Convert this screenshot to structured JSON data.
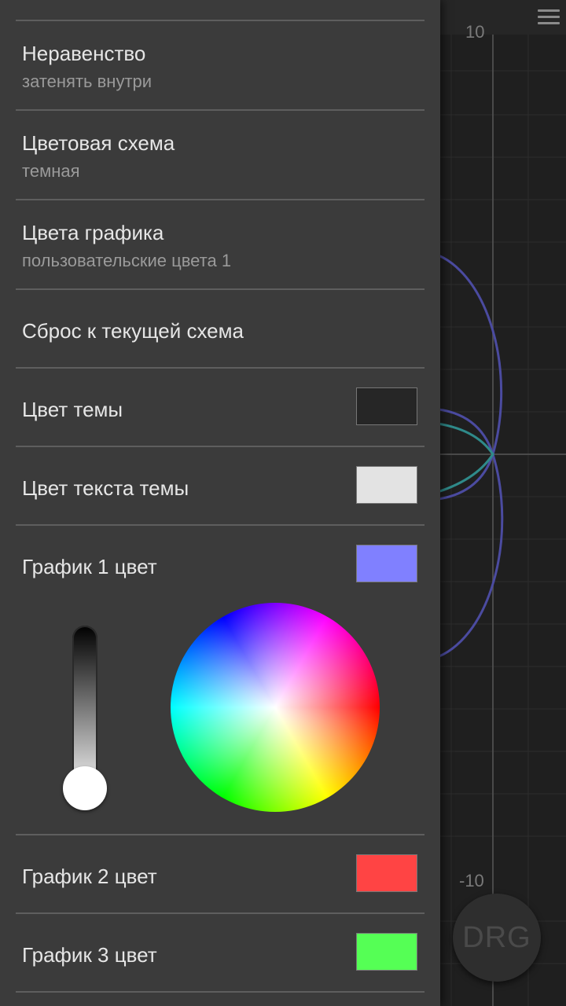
{
  "graph": {
    "tick_top": "10",
    "tick_bottom": "-10",
    "fab_label": "DRG"
  },
  "settings": {
    "inequality": {
      "title": "Неравенство",
      "value": "затенять внутри"
    },
    "color_scheme": {
      "title": "Цветовая схема",
      "value": "темная"
    },
    "graph_colors": {
      "title": "Цвета графика",
      "value": "пользовательские цвета 1"
    },
    "reset": {
      "title": "Сброс к текущей схема"
    },
    "theme_color": {
      "title": "Цвет темы",
      "color": "#262626"
    },
    "theme_text_color": {
      "title": "Цвет текста темы",
      "color": "#e3e3e3"
    },
    "graph1_color": {
      "title": "График 1 цвет",
      "color": "#8080ff"
    },
    "graph2_color": {
      "title": "График 2 цвет",
      "color": "#ff4444"
    },
    "graph3_color": {
      "title": "График 3 цвет",
      "color": "#55ff55"
    }
  },
  "picker": {
    "brightness": 1.0
  }
}
